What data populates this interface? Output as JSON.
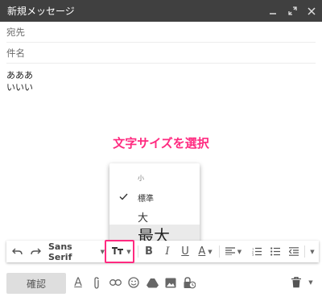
{
  "window": {
    "title": "新規メッセージ"
  },
  "fields": {
    "to_placeholder": "宛先",
    "subject_placeholder": "件名"
  },
  "body": {
    "line1": "あああ",
    "line2": "いいい"
  },
  "annotation": {
    "text": "文字サイズを選択",
    "color": "#ff2a80"
  },
  "size_menu": {
    "items": [
      {
        "label": "小",
        "checked": false
      },
      {
        "label": "標準",
        "checked": true
      },
      {
        "label": "大",
        "checked": false
      },
      {
        "label": "最大",
        "checked": false,
        "hovered": true
      }
    ]
  },
  "toolbar": {
    "font_label": "Sans Serif",
    "icons": [
      "undo-icon",
      "redo-icon",
      "font-family",
      "text-size-icon",
      "bold-icon",
      "italic-icon",
      "underline-icon",
      "text-color-icon",
      "align-icon",
      "numbered-list-icon",
      "bulleted-list-icon",
      "indent-less-icon",
      "more-options-icon"
    ]
  },
  "bottom": {
    "send_label": "確認",
    "icons": [
      "formatting-icon",
      "attach-icon",
      "link-icon",
      "emoji-icon",
      "drive-icon",
      "photo-icon",
      "confidential-icon",
      "trash-icon",
      "more-icon"
    ]
  },
  "colors": {
    "titlebar": "#404040",
    "highlight": "#ff2a80"
  }
}
